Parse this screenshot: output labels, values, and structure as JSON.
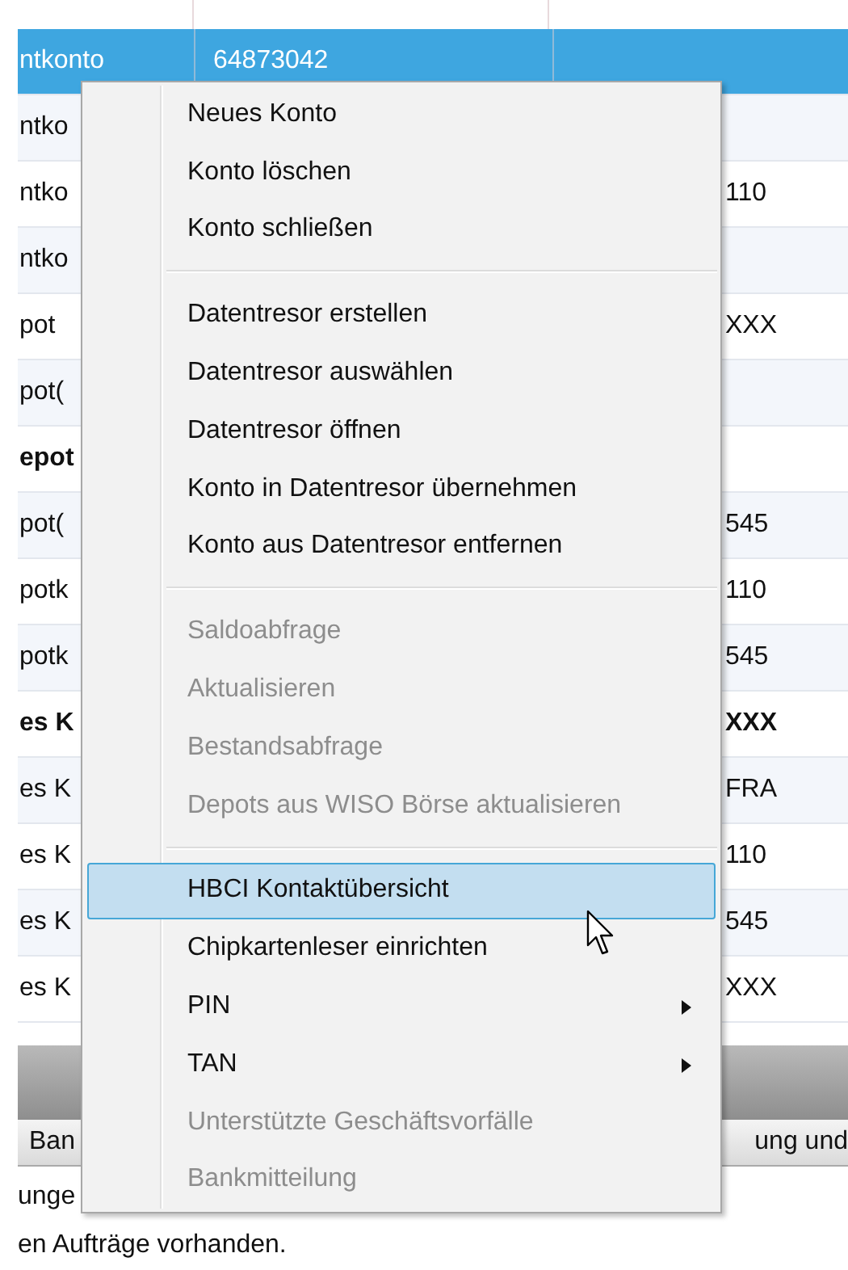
{
  "table": {
    "rows": [
      {
        "column_1": "ntkonto",
        "column_2": "64873042",
        "column_3": "",
        "selected": true,
        "bold": false
      },
      {
        "column_1": "ntko",
        "column_2": "",
        "column_3": "",
        "selected": false,
        "bold": false
      },
      {
        "column_1": "ntko",
        "column_2": "",
        "column_3": "110",
        "selected": false,
        "bold": false
      },
      {
        "column_1": "ntko",
        "column_2": "",
        "column_3": "",
        "selected": false,
        "bold": false
      },
      {
        "column_1": "pot",
        "column_2": "",
        "column_3": "XXX",
        "selected": false,
        "bold": false
      },
      {
        "column_1": "pot(",
        "column_2": "",
        "column_3": "",
        "selected": false,
        "bold": false
      },
      {
        "column_1": "epot",
        "column_2": "",
        "column_3": "",
        "selected": false,
        "bold": true
      },
      {
        "column_1": "pot(",
        "column_2": "",
        "column_3": "545",
        "selected": false,
        "bold": false
      },
      {
        "column_1": "potk",
        "column_2": "",
        "column_3": "110",
        "selected": false,
        "bold": false
      },
      {
        "column_1": "potk",
        "column_2": "",
        "column_3": "545",
        "selected": false,
        "bold": false
      },
      {
        "column_1": "es K",
        "column_2": "",
        "column_3": "XXX",
        "selected": false,
        "bold": true
      },
      {
        "column_1": "es K",
        "column_2": "",
        "column_3": "FRA",
        "selected": false,
        "bold": false
      },
      {
        "column_1": "es K",
        "column_2": "",
        "column_3": "110",
        "selected": false,
        "bold": false
      },
      {
        "column_1": "es K",
        "column_2": "",
        "column_3": "545",
        "selected": false,
        "bold": false
      },
      {
        "column_1": "es K",
        "column_2": "",
        "column_3": "XXX",
        "selected": false,
        "bold": false
      }
    ]
  },
  "bottom_tabs": [
    {
      "label": "Ban"
    },
    {
      "label": "ung und"
    }
  ],
  "bottom_lines": [
    "unge",
    "en Aufträge vorhanden."
  ],
  "context_menu": {
    "items": [
      {
        "kind": "item",
        "label": "Neues Konto",
        "disabled": false,
        "selected": false,
        "submenu": false
      },
      {
        "kind": "item",
        "label": "Konto löschen",
        "disabled": false,
        "selected": false,
        "submenu": false
      },
      {
        "kind": "item",
        "label": "Konto schließen",
        "disabled": false,
        "selected": false,
        "submenu": false
      },
      {
        "kind": "separator"
      },
      {
        "kind": "item",
        "label": "Datentresor erstellen",
        "disabled": false,
        "selected": false,
        "submenu": false
      },
      {
        "kind": "item",
        "label": "Datentresor auswählen",
        "disabled": false,
        "selected": false,
        "submenu": false
      },
      {
        "kind": "item",
        "label": "Datentresor öffnen",
        "disabled": false,
        "selected": false,
        "submenu": false
      },
      {
        "kind": "item",
        "label": "Konto in Datentresor übernehmen",
        "disabled": false,
        "selected": false,
        "submenu": false
      },
      {
        "kind": "item",
        "label": "Konto aus Datentresor entfernen",
        "disabled": false,
        "selected": false,
        "submenu": false
      },
      {
        "kind": "separator"
      },
      {
        "kind": "item",
        "label": "Saldoabfrage",
        "disabled": true,
        "selected": false,
        "submenu": false
      },
      {
        "kind": "item",
        "label": "Aktualisieren",
        "disabled": true,
        "selected": false,
        "submenu": false
      },
      {
        "kind": "item",
        "label": "Bestandsabfrage",
        "disabled": true,
        "selected": false,
        "submenu": false
      },
      {
        "kind": "item",
        "label": "Depots aus WISO Börse aktualisieren",
        "disabled": true,
        "selected": false,
        "submenu": false
      },
      {
        "kind": "separator"
      },
      {
        "kind": "item",
        "label": "HBCI Kontaktübersicht",
        "disabled": false,
        "selected": true,
        "submenu": false
      },
      {
        "kind": "item",
        "label": "Chipkartenleser einrichten",
        "disabled": false,
        "selected": false,
        "submenu": false
      },
      {
        "kind": "item",
        "label": "PIN",
        "disabled": false,
        "selected": false,
        "submenu": true
      },
      {
        "kind": "item",
        "label": "TAN",
        "disabled": false,
        "selected": false,
        "submenu": true
      },
      {
        "kind": "item",
        "label": "Unterstützte Geschäftsvorfälle",
        "disabled": true,
        "selected": false,
        "submenu": false
      },
      {
        "kind": "item",
        "label": "Bankmitteilung",
        "disabled": true,
        "selected": false,
        "submenu": false
      }
    ]
  }
}
